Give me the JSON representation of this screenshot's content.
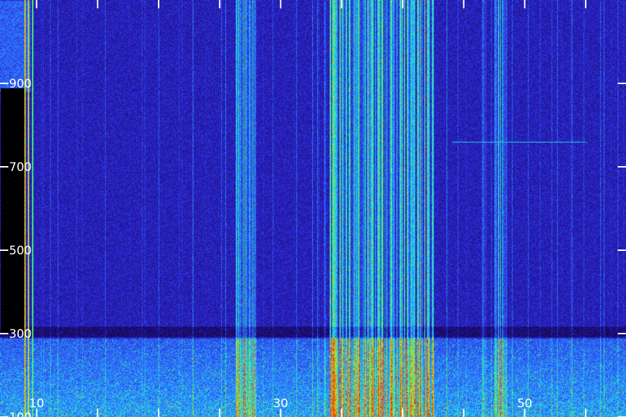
{
  "chart_data": {
    "type": "heatmap",
    "title": "",
    "xlabel": "",
    "ylabel": "",
    "xlim": [
      7,
      58.3
    ],
    "ylim": [
      100,
      1100
    ],
    "x_ticks": [
      {
        "value": 10,
        "label": "10"
      },
      {
        "value": 30,
        "label": "30"
      },
      {
        "value": 50,
        "label": "50"
      }
    ],
    "x_minor_ticks": [
      5,
      15,
      20,
      25,
      35,
      40,
      45,
      55
    ],
    "y_ticks": [
      {
        "value": 100,
        "label": "100"
      },
      {
        "value": 300,
        "label": "300"
      },
      {
        "value": 500,
        "label": "500"
      },
      {
        "value": 700,
        "label": "700"
      },
      {
        "value": 900,
        "label": "900"
      }
    ],
    "colormap": [
      "#000000",
      "#1a0a66",
      "#2a22cc",
      "#2f6fff",
      "#22c8ff",
      "#2aff7a",
      "#ffd200",
      "#ff3000"
    ],
    "background_color": "#0a0430",
    "features": {
      "gap_region": {
        "x": [
          7,
          9.0
        ],
        "y": [
          300,
          890
        ],
        "level": 0.0
      },
      "bright_band_left": {
        "x": [
          7,
          9.5
        ],
        "y": [
          880,
          1100
        ],
        "level": 0.35
      },
      "low_band": {
        "y": [
          100,
          290
        ],
        "level": 0.45
      },
      "dark_band": {
        "y": [
          292,
          318
        ],
        "level": 0.2
      },
      "strong_lines": [
        {
          "x": 9.0,
          "level": 0.95
        },
        {
          "x": 9.3,
          "level": 0.9
        },
        {
          "x": 9.6,
          "level": 0.8
        }
      ],
      "line_clusters": [
        {
          "x": [
            26.3,
            28.0
          ],
          "level": 0.55
        },
        {
          "x": [
            34.0,
            42.5
          ],
          "level": 0.65
        },
        {
          "x": [
            47.5,
            48.5
          ],
          "level": 0.55
        }
      ],
      "horizontal_segment": {
        "x": [
          44,
          55
        ],
        "y": 760,
        "level": 0.6
      }
    }
  },
  "colors": {
    "tick": "#ffffff",
    "label": "#ffffff"
  }
}
